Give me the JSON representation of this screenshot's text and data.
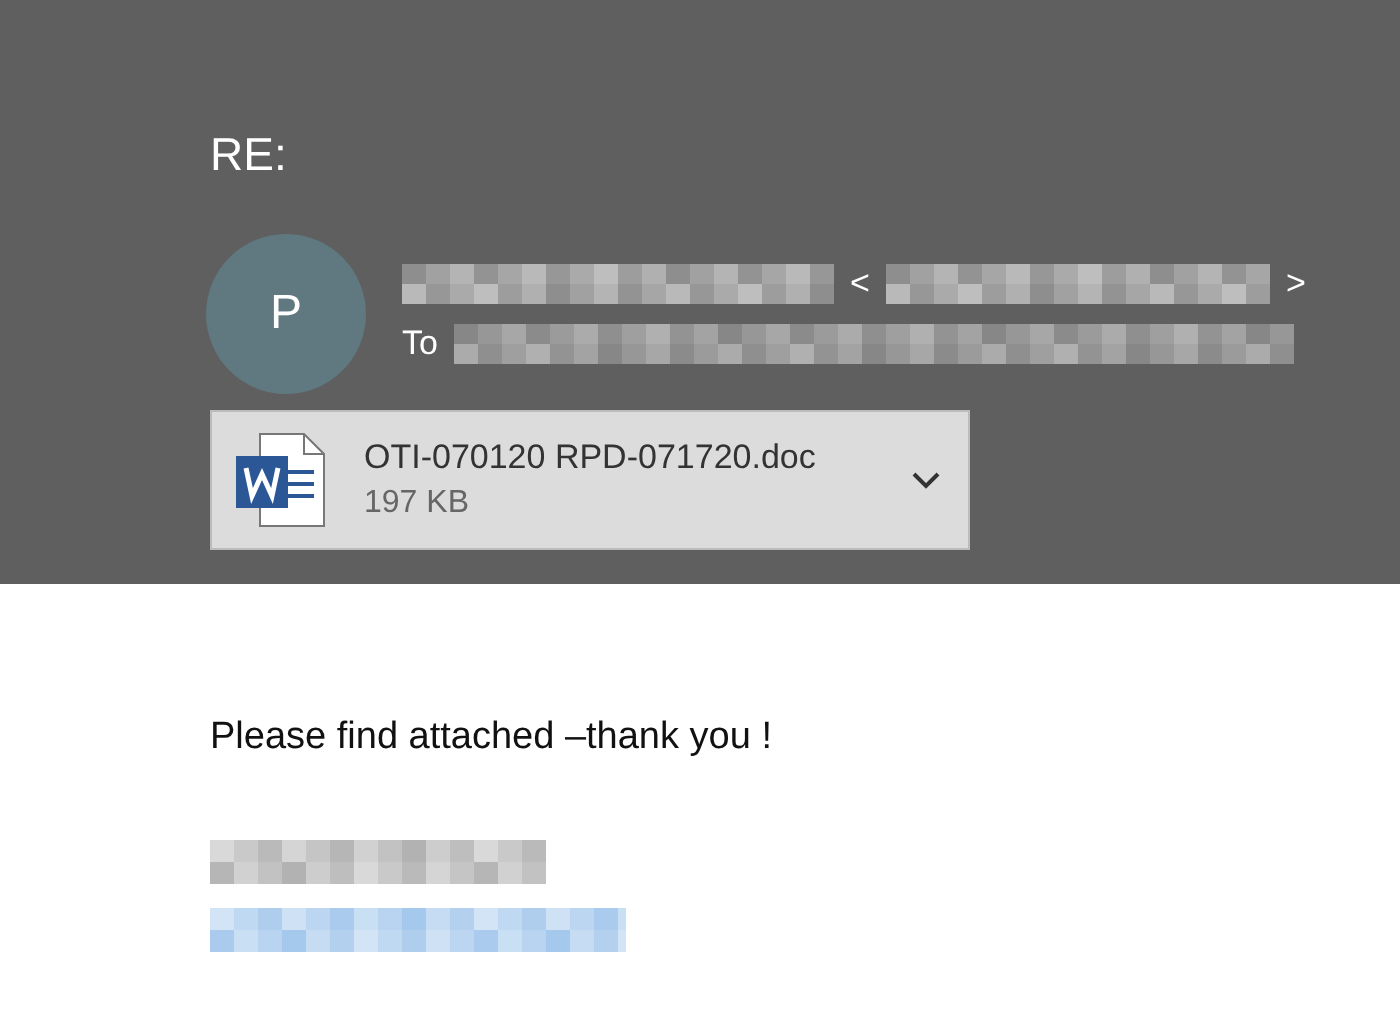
{
  "subject": "RE:",
  "sender": {
    "initial": "P",
    "open_bracket": "<",
    "close_bracket": ">"
  },
  "recipients": {
    "label": "To"
  },
  "attachment": {
    "name": "OTI-070120 RPD-071720.doc",
    "size": "197 KB"
  },
  "body": {
    "text": "Please find attached –thank you !"
  }
}
